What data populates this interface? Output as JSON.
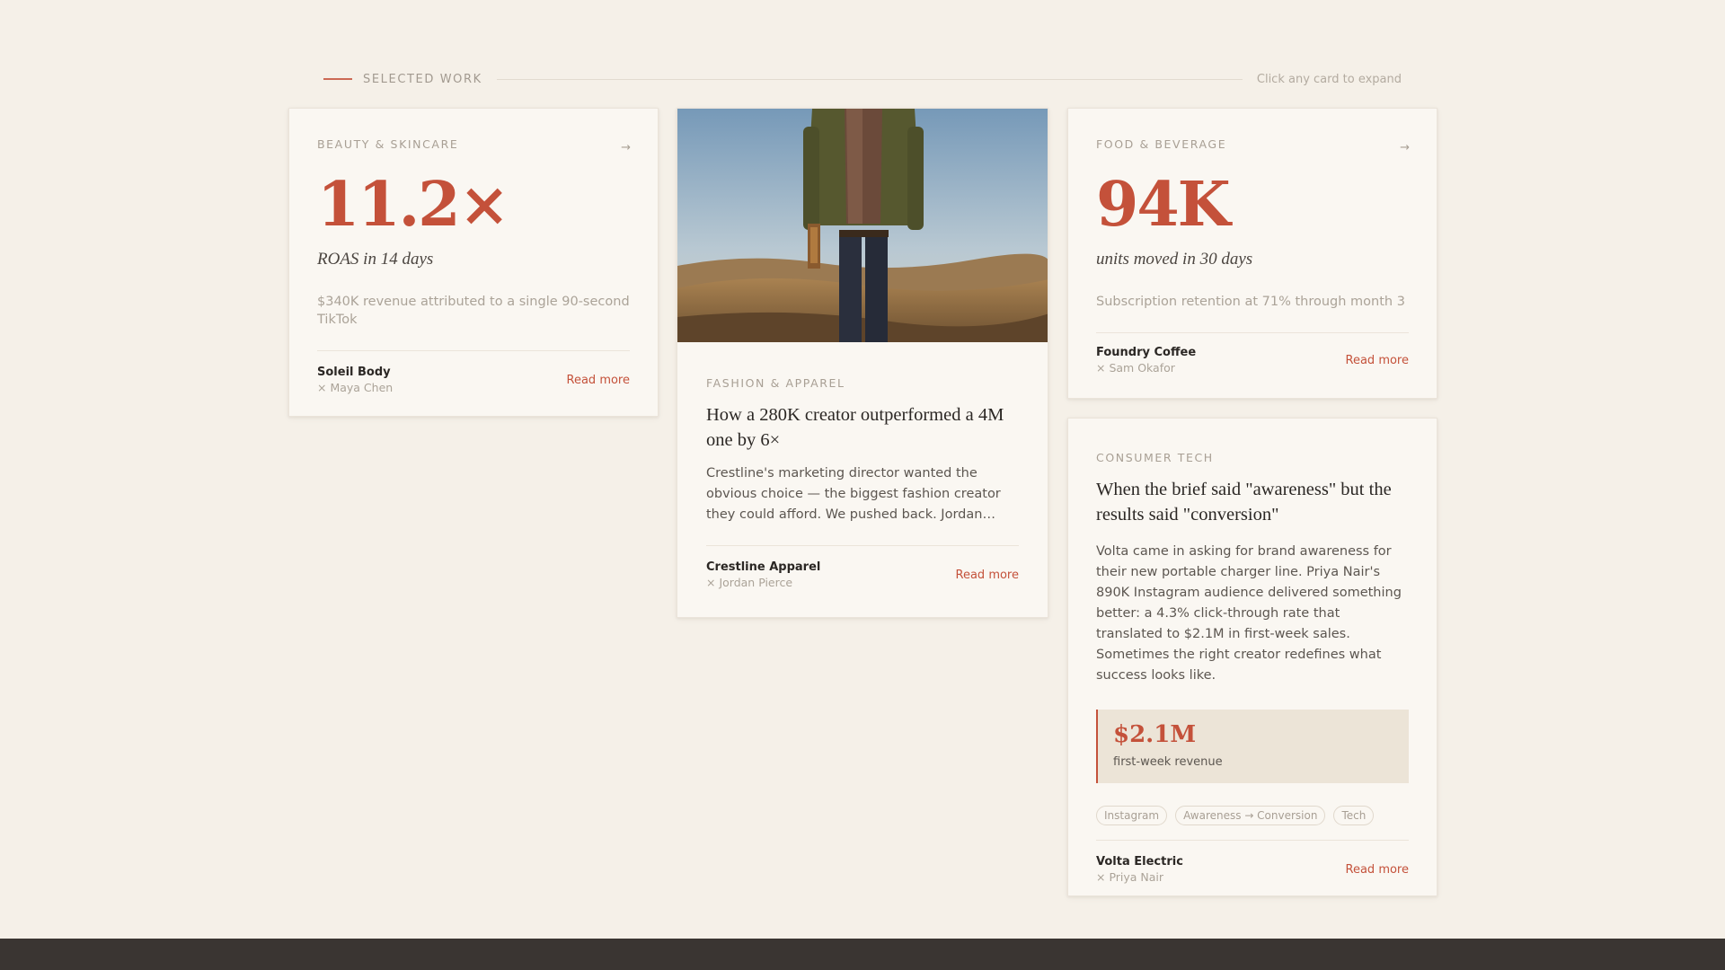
{
  "section": {
    "title": "SELECTED WORK",
    "hint": "Click any card to expand"
  },
  "cards": [
    {
      "category": "BEAUTY & SKINCARE",
      "arrow": "→",
      "stat": "11.2×",
      "stat_label": "ROAS in 14 days",
      "description": "$340K revenue attributed to a single 90-second TikTok",
      "client": "Soleil Body",
      "creator": "× Maya Chen",
      "read_more": "Read more"
    },
    {
      "category": "FASHION & APPAREL",
      "headline": "How a 280K creator outperformed a 4M one by 6×",
      "body": "Crestline's marketing director wanted the obvious choice — the biggest fashion creator they could afford. We pushed back. Jordan…",
      "client": "Crestline Apparel",
      "creator": "× Jordan Pierce",
      "read_more": "Read more"
    },
    {
      "category": "FOOD & BEVERAGE",
      "arrow": "→",
      "stat": "94K",
      "stat_label": "units moved in 30 days",
      "description": "Subscription retention at 71% through month 3",
      "client": "Foundry Coffee",
      "creator": "× Sam Okafor",
      "read_more": "Read more"
    },
    {
      "category": "CONSUMER TECH",
      "headline": "When the brief said \"awareness\" but the results said \"conversion\"",
      "body": "Volta came in asking for brand awareness for their new portable charger line. Priya Nair's 890K Instagram audience delivered something better: a 4.3% click-through rate that translated to $2.1M in first-week sales. Sometimes the right creator redefines what success looks like.",
      "metric_value": "$2.1M",
      "metric_label": "first-week revenue",
      "tags": [
        "Instagram",
        "Awareness → Conversion",
        "Tech"
      ],
      "client": "Volta Electric",
      "creator": "× Priya Nair",
      "read_more": "Read more"
    }
  ],
  "colors": {
    "accent": "#c4513a",
    "background": "#f5f0e8",
    "card": "#faf7f2",
    "footer_bar": "#3a3532"
  }
}
